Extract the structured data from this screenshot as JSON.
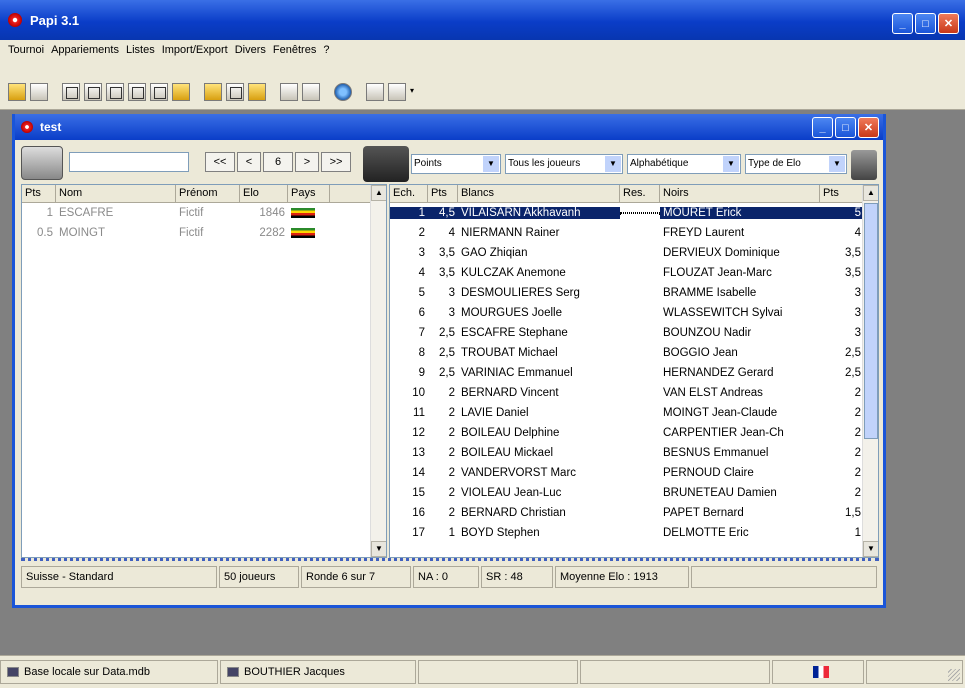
{
  "app": {
    "title": "Papi 3.1"
  },
  "menu": [
    "Tournoi",
    "Appariements",
    "Listes",
    "Import/Export",
    "Divers",
    "Fenêtres",
    "?"
  ],
  "child": {
    "title": "test",
    "nav": {
      "first": "<<",
      "prev": "<",
      "round": "6",
      "next": ">",
      "last": ">>"
    },
    "dropdowns": [
      "Points",
      "Tous les joueurs",
      "Alphabétique",
      "Type de Elo"
    ]
  },
  "left_table": {
    "headers": [
      "Pts",
      "Nom",
      "Prénom",
      "Elo",
      "Pays"
    ],
    "rows": [
      {
        "pts": "1",
        "nom": "ESCAFRE",
        "prenom": "Fictif",
        "elo": "1846"
      },
      {
        "pts": "0.5",
        "nom": "MOINGT",
        "prenom": "Fictif",
        "elo": "2282"
      }
    ]
  },
  "right_table": {
    "headers": [
      "Ech.",
      "Pts",
      "Blancs",
      "Res.",
      "Noirs",
      "Pts"
    ],
    "rows": [
      {
        "ech": "1",
        "pts": "4,5",
        "blancs": "VILAISARN Akkhavanh",
        "res": "",
        "noirs": "MOURET Erick",
        "pts2": "5"
      },
      {
        "ech": "2",
        "pts": "4",
        "blancs": "NIERMANN Rainer",
        "res": "",
        "noirs": "FREYD Laurent",
        "pts2": "4"
      },
      {
        "ech": "3",
        "pts": "3,5",
        "blancs": "GAO Zhiqian",
        "res": "",
        "noirs": "DERVIEUX Dominique",
        "pts2": "3,5"
      },
      {
        "ech": "4",
        "pts": "3,5",
        "blancs": "KULCZAK Anemone",
        "res": "",
        "noirs": "FLOUZAT Jean-Marc",
        "pts2": "3,5"
      },
      {
        "ech": "5",
        "pts": "3",
        "blancs": "DESMOULIERES Serg",
        "res": "",
        "noirs": "BRAMME Isabelle",
        "pts2": "3"
      },
      {
        "ech": "6",
        "pts": "3",
        "blancs": "MOURGUES Joelle",
        "res": "",
        "noirs": "WLASSEWITCH Sylvai",
        "pts2": "3"
      },
      {
        "ech": "7",
        "pts": "2,5",
        "blancs": "ESCAFRE Stephane",
        "res": "",
        "noirs": "BOUNZOU Nadir",
        "pts2": "3"
      },
      {
        "ech": "8",
        "pts": "2,5",
        "blancs": "TROUBAT Michael",
        "res": "",
        "noirs": "BOGGIO Jean",
        "pts2": "2,5"
      },
      {
        "ech": "9",
        "pts": "2,5",
        "blancs": "VARINIAC Emmanuel",
        "res": "",
        "noirs": "HERNANDEZ Gerard",
        "pts2": "2,5"
      },
      {
        "ech": "10",
        "pts": "2",
        "blancs": "BERNARD Vincent",
        "res": "",
        "noirs": "VAN ELST Andreas",
        "pts2": "2"
      },
      {
        "ech": "11",
        "pts": "2",
        "blancs": "LAVIE Daniel",
        "res": "",
        "noirs": "MOINGT Jean-Claude",
        "pts2": "2"
      },
      {
        "ech": "12",
        "pts": "2",
        "blancs": "BOILEAU Delphine",
        "res": "",
        "noirs": "CARPENTIER Jean-Ch",
        "pts2": "2"
      },
      {
        "ech": "13",
        "pts": "2",
        "blancs": "BOILEAU Mickael",
        "res": "",
        "noirs": "BESNUS Emmanuel",
        "pts2": "2"
      },
      {
        "ech": "14",
        "pts": "2",
        "blancs": "VANDERVORST Marc",
        "res": "",
        "noirs": "PERNOUD Claire",
        "pts2": "2"
      },
      {
        "ech": "15",
        "pts": "2",
        "blancs": "VIOLEAU Jean-Luc",
        "res": "",
        "noirs": "BRUNETEAU Damien",
        "pts2": "2"
      },
      {
        "ech": "16",
        "pts": "2",
        "blancs": "BERNARD Christian",
        "res": "",
        "noirs": "PAPET Bernard",
        "pts2": "1,5"
      },
      {
        "ech": "17",
        "pts": "1",
        "blancs": "BOYD Stephen",
        "res": "",
        "noirs": "DELMOTTE Eric",
        "pts2": "1"
      }
    ]
  },
  "status": [
    "Suisse - Standard",
    "50 joueurs",
    "Ronde 6 sur 7",
    "NA : 0",
    "SR : 48",
    "Moyenne Elo : 1913"
  ],
  "bottom": {
    "db": "Base locale sur Data.mdb",
    "user": "BOUTHIER Jacques"
  }
}
